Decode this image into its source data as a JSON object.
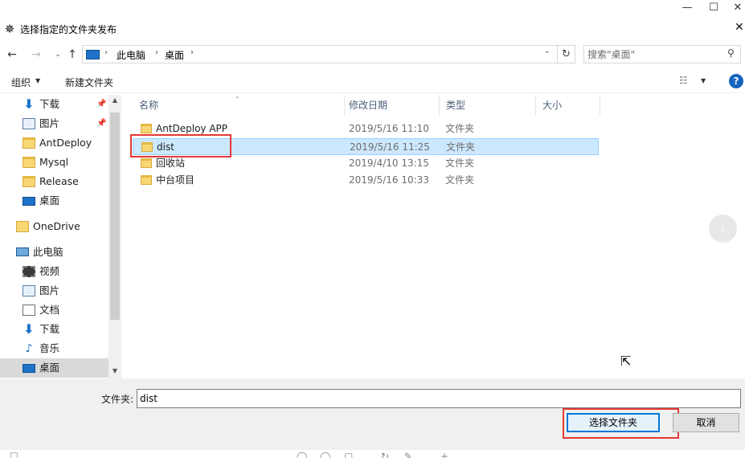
{
  "window": {
    "title": "选择指定的文件夹发布",
    "app_icon": "ant-icon",
    "min_glyph": "—",
    "max_glyph": "☐",
    "close_glyph": "✕"
  },
  "address": {
    "crumbs": [
      "此电脑",
      "桌面"
    ],
    "sep": "›",
    "search_placeholder": "搜索\"桌面\""
  },
  "toolbar": {
    "organize_label": "组织",
    "new_folder_label": "新建文件夹",
    "help_label": "?"
  },
  "nav": {
    "items": [
      {
        "label": "下载",
        "icon": "download-icon",
        "pinned": true
      },
      {
        "label": "图片",
        "icon": "pictures-icon",
        "pinned": true
      },
      {
        "label": "AntDeploy",
        "icon": "folder-icon"
      },
      {
        "label": "Mysql",
        "icon": "folder-icon"
      },
      {
        "label": "Release",
        "icon": "folder-icon"
      },
      {
        "label": "桌面",
        "icon": "desktop-icon"
      },
      {
        "label": "OneDrive",
        "icon": "onedrive-icon"
      },
      {
        "label": "此电脑",
        "icon": "pc-icon"
      },
      {
        "label": "视频",
        "icon": "video-icon"
      },
      {
        "label": "图片",
        "icon": "pictures-icon"
      },
      {
        "label": "文档",
        "icon": "documents-icon"
      },
      {
        "label": "下载",
        "icon": "download-icon"
      },
      {
        "label": "音乐",
        "icon": "music-icon"
      },
      {
        "label": "桌面",
        "icon": "desktop-icon",
        "selected": true
      }
    ]
  },
  "columns": {
    "name": "名称",
    "date": "修改日期",
    "type": "类型",
    "size": "大小"
  },
  "files": [
    {
      "name": "AntDeploy APP",
      "date": "2019/5/16 11:10",
      "type": "文件夹"
    },
    {
      "name": "dist",
      "date": "2019/5/16 11:25",
      "type": "文件夹",
      "selected": true
    },
    {
      "name": "回收站",
      "date": "2019/4/10 13:15",
      "type": "文件夹"
    },
    {
      "name": "中台项目",
      "date": "2019/5/16 10:33",
      "type": "文件夹"
    }
  ],
  "bottom": {
    "folder_label": "文件夹:",
    "folder_value": "dist",
    "select_label": "选择文件夹",
    "cancel_label": "取消"
  },
  "colors": {
    "selection_bg": "#cce8ff",
    "highlight_red": "#e53935",
    "accent_blue": "#0078d7"
  }
}
